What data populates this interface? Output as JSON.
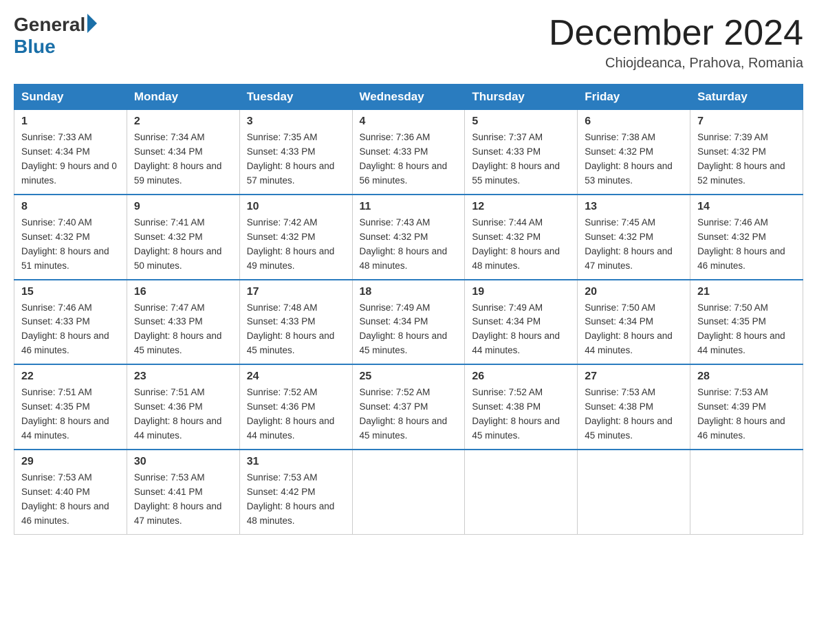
{
  "logo": {
    "general": "General",
    "blue": "Blue"
  },
  "title": "December 2024",
  "subtitle": "Chiojdeanca, Prahova, Romania",
  "weekdays": [
    "Sunday",
    "Monday",
    "Tuesday",
    "Wednesday",
    "Thursday",
    "Friday",
    "Saturday"
  ],
  "weeks": [
    [
      {
        "day": "1",
        "sunrise": "7:33 AM",
        "sunset": "4:34 PM",
        "daylight": "9 hours and 0 minutes."
      },
      {
        "day": "2",
        "sunrise": "7:34 AM",
        "sunset": "4:34 PM",
        "daylight": "8 hours and 59 minutes."
      },
      {
        "day": "3",
        "sunrise": "7:35 AM",
        "sunset": "4:33 PM",
        "daylight": "8 hours and 57 minutes."
      },
      {
        "day": "4",
        "sunrise": "7:36 AM",
        "sunset": "4:33 PM",
        "daylight": "8 hours and 56 minutes."
      },
      {
        "day": "5",
        "sunrise": "7:37 AM",
        "sunset": "4:33 PM",
        "daylight": "8 hours and 55 minutes."
      },
      {
        "day": "6",
        "sunrise": "7:38 AM",
        "sunset": "4:32 PM",
        "daylight": "8 hours and 53 minutes."
      },
      {
        "day": "7",
        "sunrise": "7:39 AM",
        "sunset": "4:32 PM",
        "daylight": "8 hours and 52 minutes."
      }
    ],
    [
      {
        "day": "8",
        "sunrise": "7:40 AM",
        "sunset": "4:32 PM",
        "daylight": "8 hours and 51 minutes."
      },
      {
        "day": "9",
        "sunrise": "7:41 AM",
        "sunset": "4:32 PM",
        "daylight": "8 hours and 50 minutes."
      },
      {
        "day": "10",
        "sunrise": "7:42 AM",
        "sunset": "4:32 PM",
        "daylight": "8 hours and 49 minutes."
      },
      {
        "day": "11",
        "sunrise": "7:43 AM",
        "sunset": "4:32 PM",
        "daylight": "8 hours and 48 minutes."
      },
      {
        "day": "12",
        "sunrise": "7:44 AM",
        "sunset": "4:32 PM",
        "daylight": "8 hours and 48 minutes."
      },
      {
        "day": "13",
        "sunrise": "7:45 AM",
        "sunset": "4:32 PM",
        "daylight": "8 hours and 47 minutes."
      },
      {
        "day": "14",
        "sunrise": "7:46 AM",
        "sunset": "4:32 PM",
        "daylight": "8 hours and 46 minutes."
      }
    ],
    [
      {
        "day": "15",
        "sunrise": "7:46 AM",
        "sunset": "4:33 PM",
        "daylight": "8 hours and 46 minutes."
      },
      {
        "day": "16",
        "sunrise": "7:47 AM",
        "sunset": "4:33 PM",
        "daylight": "8 hours and 45 minutes."
      },
      {
        "day": "17",
        "sunrise": "7:48 AM",
        "sunset": "4:33 PM",
        "daylight": "8 hours and 45 minutes."
      },
      {
        "day": "18",
        "sunrise": "7:49 AM",
        "sunset": "4:34 PM",
        "daylight": "8 hours and 45 minutes."
      },
      {
        "day": "19",
        "sunrise": "7:49 AM",
        "sunset": "4:34 PM",
        "daylight": "8 hours and 44 minutes."
      },
      {
        "day": "20",
        "sunrise": "7:50 AM",
        "sunset": "4:34 PM",
        "daylight": "8 hours and 44 minutes."
      },
      {
        "day": "21",
        "sunrise": "7:50 AM",
        "sunset": "4:35 PM",
        "daylight": "8 hours and 44 minutes."
      }
    ],
    [
      {
        "day": "22",
        "sunrise": "7:51 AM",
        "sunset": "4:35 PM",
        "daylight": "8 hours and 44 minutes."
      },
      {
        "day": "23",
        "sunrise": "7:51 AM",
        "sunset": "4:36 PM",
        "daylight": "8 hours and 44 minutes."
      },
      {
        "day": "24",
        "sunrise": "7:52 AM",
        "sunset": "4:36 PM",
        "daylight": "8 hours and 44 minutes."
      },
      {
        "day": "25",
        "sunrise": "7:52 AM",
        "sunset": "4:37 PM",
        "daylight": "8 hours and 45 minutes."
      },
      {
        "day": "26",
        "sunrise": "7:52 AM",
        "sunset": "4:38 PM",
        "daylight": "8 hours and 45 minutes."
      },
      {
        "day": "27",
        "sunrise": "7:53 AM",
        "sunset": "4:38 PM",
        "daylight": "8 hours and 45 minutes."
      },
      {
        "day": "28",
        "sunrise": "7:53 AM",
        "sunset": "4:39 PM",
        "daylight": "8 hours and 46 minutes."
      }
    ],
    [
      {
        "day": "29",
        "sunrise": "7:53 AM",
        "sunset": "4:40 PM",
        "daylight": "8 hours and 46 minutes."
      },
      {
        "day": "30",
        "sunrise": "7:53 AM",
        "sunset": "4:41 PM",
        "daylight": "8 hours and 47 minutes."
      },
      {
        "day": "31",
        "sunrise": "7:53 AM",
        "sunset": "4:42 PM",
        "daylight": "8 hours and 48 minutes."
      },
      null,
      null,
      null,
      null
    ]
  ]
}
